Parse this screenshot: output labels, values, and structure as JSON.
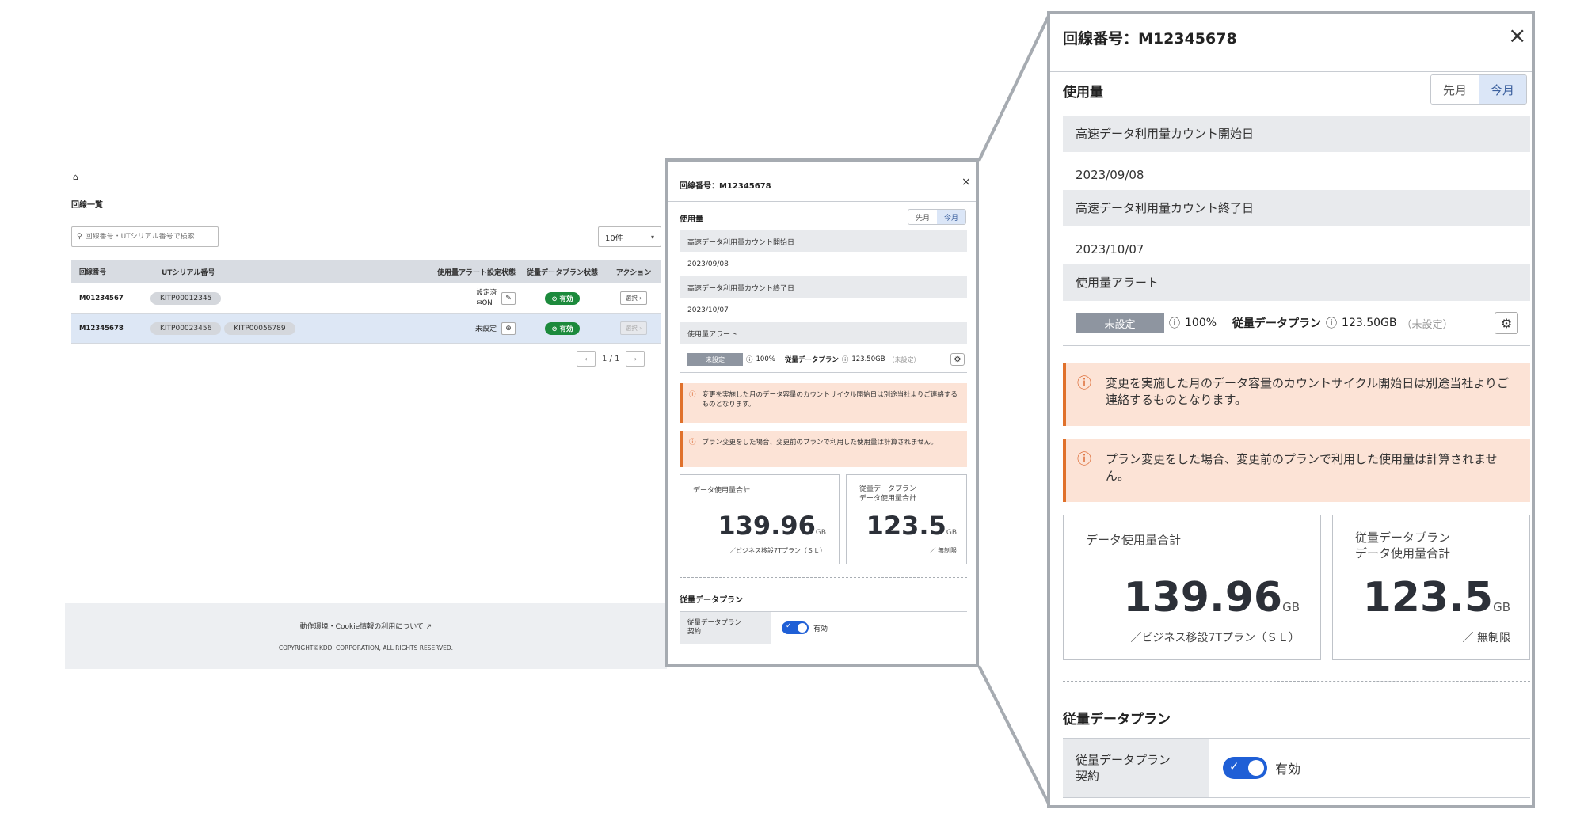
{
  "breadcrumb": {
    "home_icon": "home-icon"
  },
  "list": {
    "title": "回線一覧",
    "search_placeholder": "回線番号・UTシリアル番号で検索",
    "page_size": "10件",
    "columns": [
      "回線番号",
      "UTシリアル番号",
      "使用量アラート設定状態",
      "従量データプラン状態",
      "アクション"
    ],
    "rows": [
      {
        "line": "M01234567",
        "serials": [
          "KITP00012345"
        ],
        "alert_state": "設定済",
        "alert_sub": "ON",
        "plan_state": "有効",
        "action": "選択"
      },
      {
        "line": "M12345678",
        "serials": [
          "KITP00023456",
          "KITP00056789"
        ],
        "alert_state": "未設定",
        "alert_sub": "",
        "plan_state": "有効",
        "action": "選択"
      }
    ],
    "pager": "1 / 1"
  },
  "footer": {
    "link": "動作環境・Cookie情報の利用について",
    "copyright": "COPYRIGHT©KDDI CORPORATION, ALL RIGHTS RESERVED."
  },
  "panel": {
    "title": "回線番号：M12345678",
    "usage_title": "使用量",
    "seg_prev": "先月",
    "seg_curr": "今月",
    "start_label": "高速データ利用量カウント開始日",
    "start_value": "2023/09/08",
    "end_label": "高速データ利用量カウント終了日",
    "end_value": "2023/10/07",
    "alert_label": "使用量アラート",
    "alert_badge": "未設定",
    "alert_percent": "100%",
    "alert_plan_label": "従量データプラン",
    "alert_plan_value": "123.50GB",
    "alert_plan_state": "（未設定）",
    "warn1": "変更を実施した月のデータ容量のカウントサイクル開始日は別途当社よりご連絡するものとなります。",
    "warn2": "プラン変更をした場合、変更前のプランで利用した使用量は計算されません。",
    "card1_label": "データ使用量合計",
    "card1_value": "139.96",
    "card1_unit": "GB",
    "card1_sub": "／ビジネス移設7Tプラン（ＳＬ）",
    "card2_label1": "従量データプラン",
    "card2_label2": "データ使用量合計",
    "card2_value": "123.5",
    "card2_unit": "GB",
    "card2_sub": "／ 無制限",
    "plan_title": "従量データプラン",
    "contract_label1": "従量データプラン",
    "contract_label2": "契約",
    "contract_value": "有効"
  }
}
